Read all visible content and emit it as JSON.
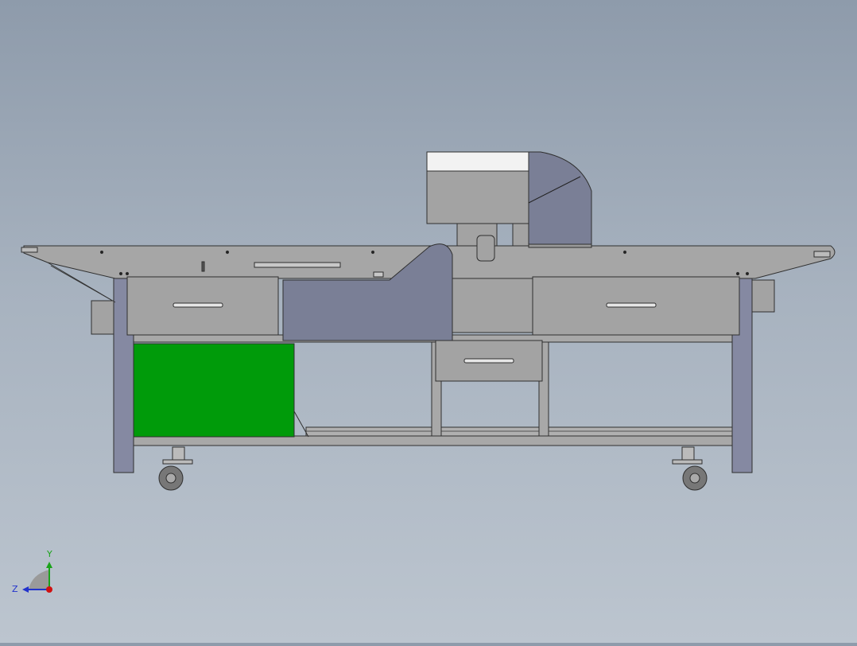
{
  "triad": {
    "y_label": "Y",
    "z_label": "Z"
  },
  "colors": {
    "background_top": "#8e9bab",
    "background_bottom": "#bcc5cf",
    "steel": "#a3a3a3",
    "steel_edge": "#2f2f2f",
    "guard_blue": "#7a7f96",
    "leg_blue": "#8589a2",
    "hood_white": "#f2f2f2",
    "green_panel": "#009b0a",
    "axis_y": "#1aa31a",
    "axis_z": "#2233cc",
    "axis_origin": "#d01010"
  },
  "model": {
    "name": "conveyor-cutting-machine",
    "view": "side"
  }
}
